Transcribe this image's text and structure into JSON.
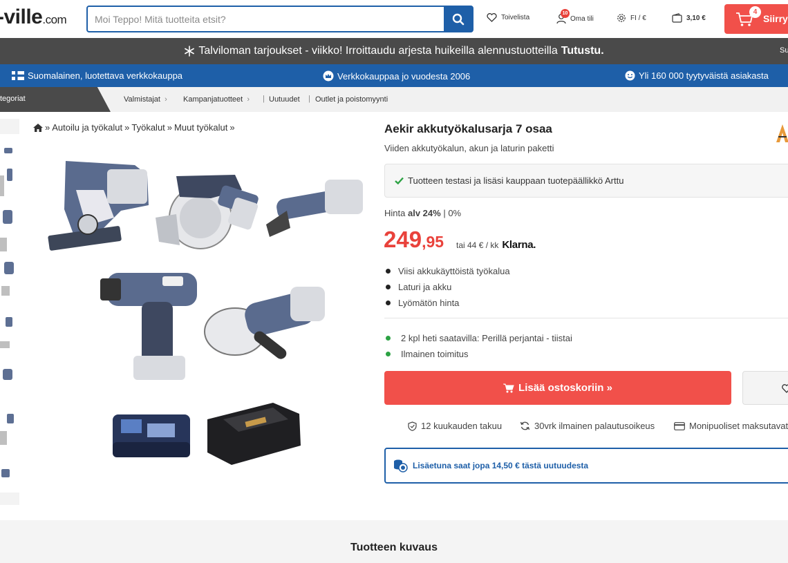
{
  "header": {
    "logo_text": "-ville",
    "logo_suffix": ".com",
    "search_placeholder": "Moi Teppo! Mitä tuotteita etsit?",
    "wishlist_label": "Toivelista",
    "account_badge": "10",
    "account_label": "Oma tili",
    "locale_label": "FI / €",
    "wallet_amount": "3,10 €",
    "cart_count": "4",
    "cart_label": "Siirry"
  },
  "promo": {
    "text": "Talviloman tarjoukset - viikko! Irroittaudu arjesta huikeilla alennustuotteilla",
    "link": "Tutustu.",
    "right_text": "Su"
  },
  "trust": {
    "items": [
      "Suomalainen, luotettava verkkokauppa",
      "Verkkokauppaa jo vuodesta 2006",
      "Yli 160 000 tyytyväistä asiakasta"
    ]
  },
  "catnav": {
    "categories_label": "tegoriat",
    "links": [
      "Valmistajat",
      "Kampanjatuotteet",
      "Uutuudet",
      "Outlet ja poistomyynti"
    ]
  },
  "breadcrumb": [
    "Autoilu ja työkalut",
    "Työkalut",
    "Muut työkalut"
  ],
  "product": {
    "title": "Aekir akkutyökalusarja 7 osaa",
    "subtitle": "Viiden akkutyökalun, akun ja laturin paketti",
    "tested_text": "Tuotteen testasi ja lisäsi kauppaan tuotepäällikkö Arttu",
    "price_label_prefix": "Hinta",
    "price_vat": "alv 24%",
    "price_vat_sep": "|",
    "price_vat_zero": "0%",
    "price_int": "249",
    "price_dec": ",95",
    "klarna_text": "tai 44 € / kk",
    "klarna_logo": "Klarna.",
    "bullets": [
      "Viisi akkukäyttöistä työkalua",
      "Laturi ja akku",
      "Lyömätön hinta"
    ],
    "availability": [
      "2 kpl heti saatavilla: Perillä perjantai - tiistai",
      "Ilmainen toimitus"
    ],
    "add_to_cart": "Lisää ostoskoriin »",
    "perks": [
      "12 kuukauden takuu",
      "30vrk ilmainen palautusoikeus",
      "Monipuoliset maksutavat"
    ],
    "bonus_text": "Lisäetuna saat jopa 14,50 € tästä uutuudesta"
  },
  "description": {
    "title": "Tuotteen kuvaus"
  },
  "colors": {
    "brand_blue": "#1e5fa8",
    "accent_red": "#f1504a",
    "dark_bar": "#4a4a4a",
    "green": "#2ca243"
  }
}
